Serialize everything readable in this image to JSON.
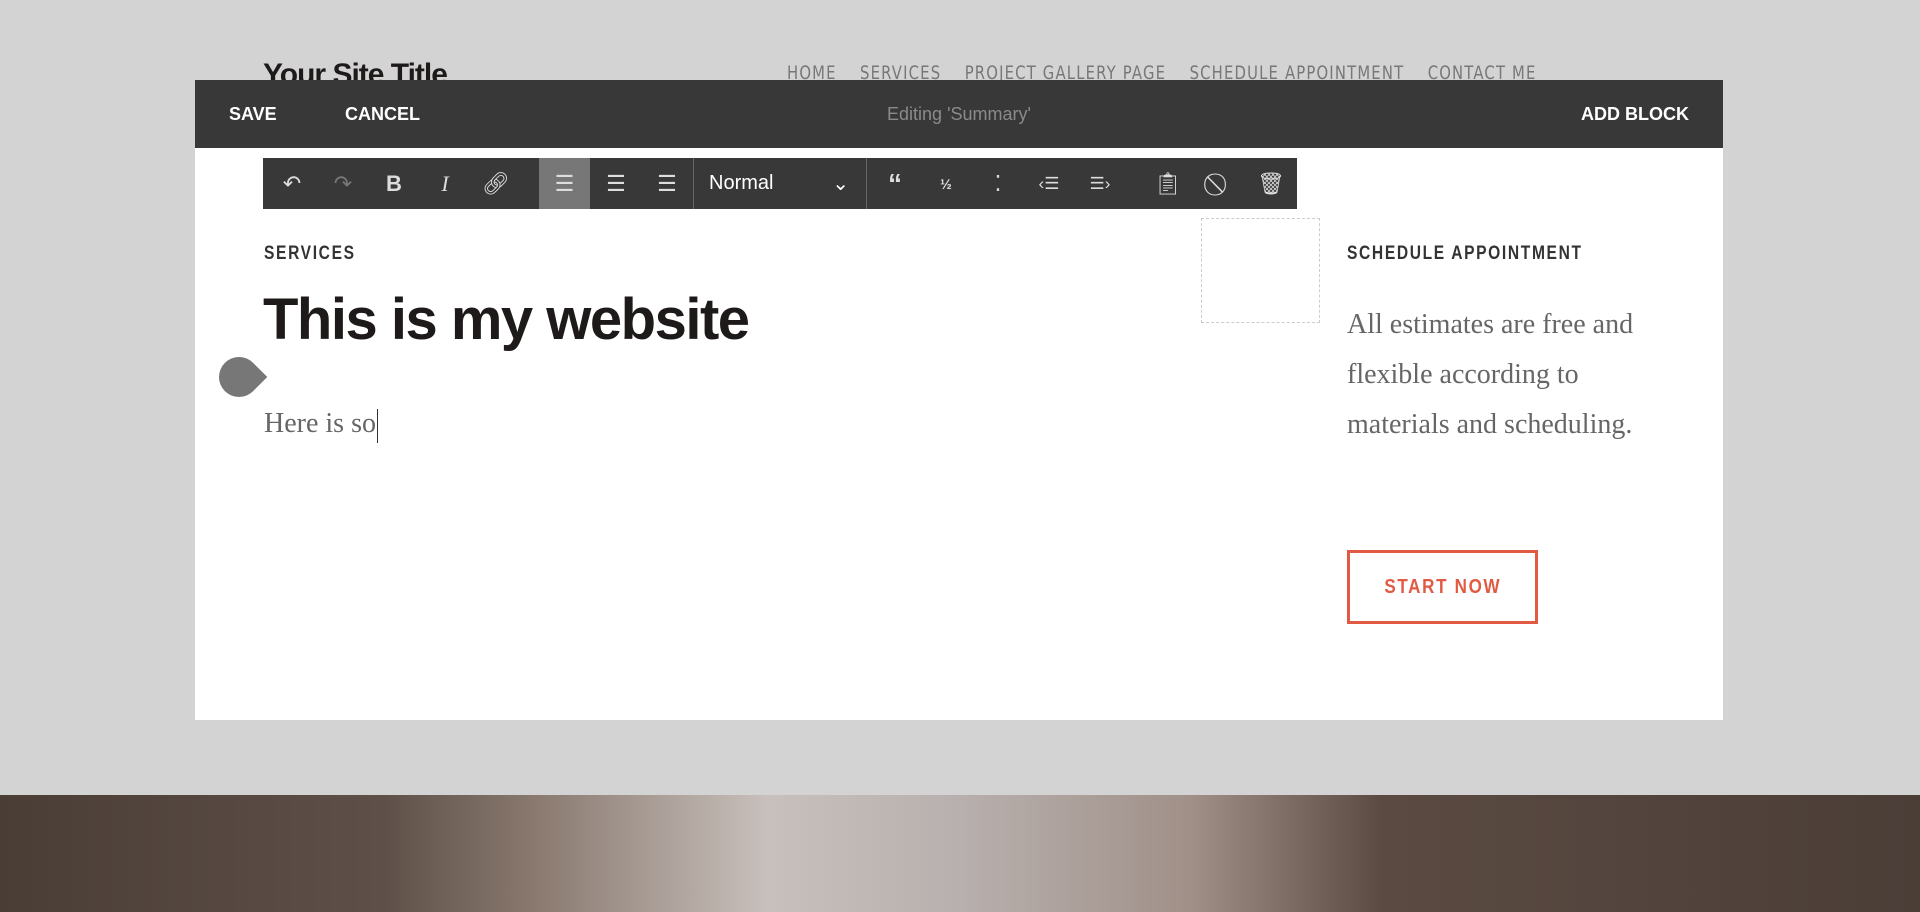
{
  "site": {
    "title": "Your Site Title",
    "nav": [
      "HOME",
      "SERVICES",
      "PROJECT GALLERY PAGE",
      "SCHEDULE APPOINTMENT",
      "CONTACT ME"
    ]
  },
  "editbar": {
    "save": "SAVE",
    "cancel": "CANCEL",
    "title": "Editing 'Summary'",
    "add_block": "ADD BLOCK"
  },
  "toolbar": {
    "format": "Normal",
    "active": "align-left"
  },
  "main": {
    "eyebrow": "SERVICES",
    "heading": "This is my website",
    "body": "Here is so"
  },
  "sidebar": {
    "eyebrow": "SCHEDULE APPOINTMENT",
    "text": "All estimates are free and flexible according to materials and scheduling.",
    "button": "START NOW"
  },
  "colors": {
    "accent": "#e05a44",
    "bar": "#383838"
  }
}
